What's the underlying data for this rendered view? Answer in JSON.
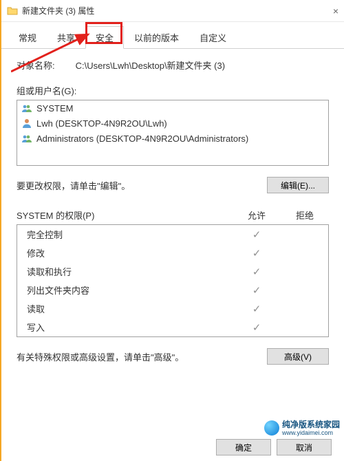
{
  "window": {
    "title": "新建文件夹 (3) 属性"
  },
  "tabs": {
    "general": "常规",
    "sharing": "共享",
    "security": "安全",
    "previous": "以前的版本",
    "custom": "自定义"
  },
  "object": {
    "label": "对象名称:",
    "path": "C:\\Users\\Lwh\\Desktop\\新建文件夹 (3)"
  },
  "groups": {
    "label": "组或用户名(G):",
    "items": [
      {
        "name": "SYSTEM",
        "icon": "group"
      },
      {
        "name": "Lwh (DESKTOP-4N9R2OU\\Lwh)",
        "icon": "user"
      },
      {
        "name": "Administrators (DESKTOP-4N9R2OU\\Administrators)",
        "icon": "group"
      }
    ]
  },
  "edit": {
    "hint": "要更改权限，请单击\"编辑\"。",
    "button": "编辑(E)..."
  },
  "permissions": {
    "header_name": "SYSTEM 的权限(P)",
    "header_allow": "允许",
    "header_deny": "拒绝",
    "rows": [
      {
        "name": "完全控制",
        "allow": true,
        "deny": false
      },
      {
        "name": "修改",
        "allow": true,
        "deny": false
      },
      {
        "name": "读取和执行",
        "allow": true,
        "deny": false
      },
      {
        "name": "列出文件夹内容",
        "allow": true,
        "deny": false
      },
      {
        "name": "读取",
        "allow": true,
        "deny": false
      },
      {
        "name": "写入",
        "allow": true,
        "deny": false
      }
    ]
  },
  "advanced": {
    "hint": "有关特殊权限或高级设置，请单击\"高级\"。",
    "button": "高级(V)"
  },
  "footer": {
    "ok": "确定",
    "cancel": "取消"
  },
  "watermark": {
    "name": "纯净版系统家园",
    "url": "www.yidaimei.com"
  }
}
